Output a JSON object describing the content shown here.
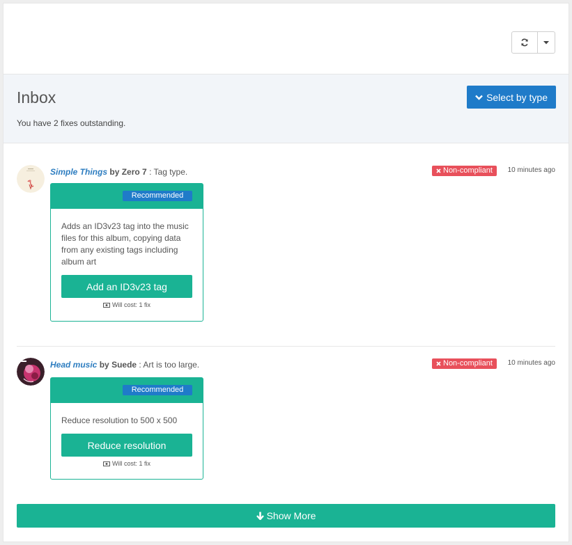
{
  "inbox": {
    "title": "Inbox",
    "subtitle": "You have 2 fixes outstanding.",
    "select_by_type_label": "Select by type"
  },
  "items": [
    {
      "album": "Simple Things",
      "by": "by",
      "artist": "Zero 7",
      "issue": ": Tag type.",
      "status": "Non-compliant",
      "time": "10 minutes ago",
      "recommended": "Recommended",
      "description": "Adds an ID3v23 tag into the music files for this album, copying data from any existing tags including album art",
      "action": "Add an ID3v23 tag",
      "cost": "Will cost: 1 fix"
    },
    {
      "album": "Head music",
      "by": "by",
      "artist": "Suede",
      "issue": ": Art is too large.",
      "status": "Non-compliant",
      "time": "10 minutes ago",
      "recommended": "Recommended",
      "description": "Reduce resolution to 500 x 500",
      "action": "Reduce resolution",
      "cost": "Will cost: 1 fix"
    }
  ],
  "show_more_label": "Show More",
  "icons": {
    "refresh": "refresh-icon",
    "caret": "caret-down-icon",
    "chevron": "chevron-down-icon",
    "close": "close-icon",
    "money": "money-icon",
    "arrow_down": "arrow-down-icon"
  },
  "colors": {
    "primary": "#1f7bc9",
    "teal": "#1ab394",
    "danger": "#e8505b"
  }
}
